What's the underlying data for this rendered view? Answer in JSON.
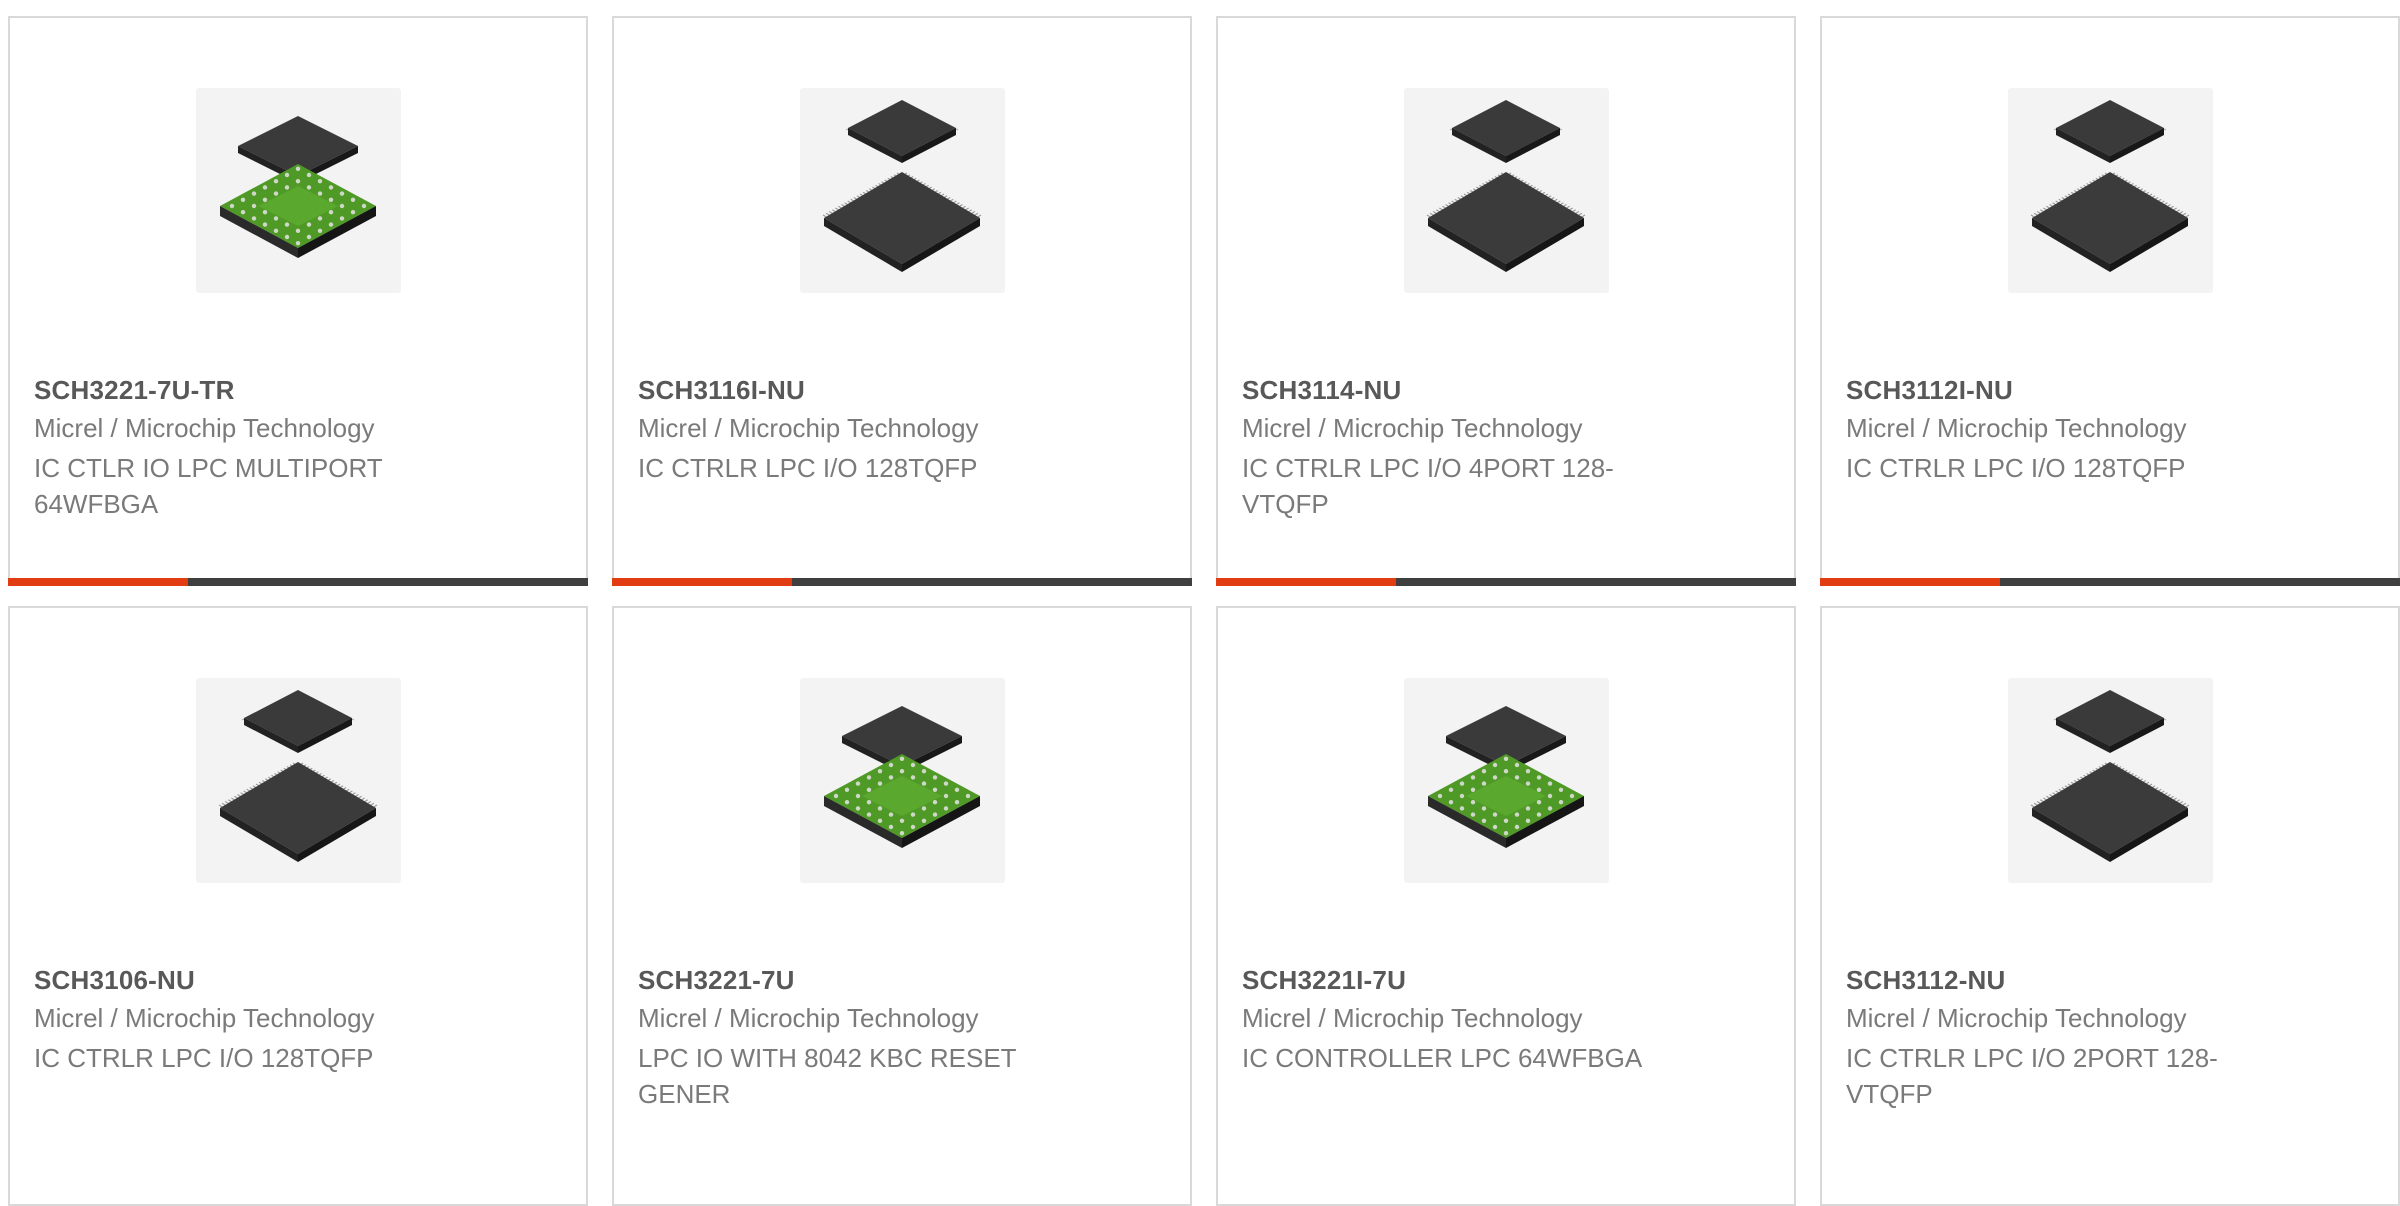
{
  "colors": {
    "accent": "#e23c12",
    "track": "#3f3f3f",
    "border": "#d9d9d9",
    "part_text": "#585858",
    "body_text": "#7a7a7a"
  },
  "products": [
    {
      "part": "SCH3221-7U-TR",
      "manufacturer": "Micrel / Microchip Technology",
      "description": "IC CTLR IO LPC MULTIPORT 64WFBGA",
      "image": "bga-chip-icon",
      "progress": 0.31
    },
    {
      "part": "SCH3116I-NU",
      "manufacturer": "Micrel / Microchip Technology",
      "description": "IC CTRLR LPC I/O 128TQFP",
      "image": "qfp-chip-icon",
      "progress": 0.31
    },
    {
      "part": "SCH3114-NU",
      "manufacturer": "Micrel / Microchip Technology",
      "description": "IC CTRLR LPC I/O 4PORT 128-VTQFP",
      "image": "qfp-chip-icon",
      "progress": 0.31
    },
    {
      "part": "SCH3112I-NU",
      "manufacturer": "Micrel / Microchip Technology",
      "description": "IC CTRLR LPC I/O 128TQFP",
      "image": "qfp-chip-icon",
      "progress": 0.31
    },
    {
      "part": "SCH3106-NU",
      "manufacturer": "Micrel / Microchip Technology",
      "description": "IC CTRLR LPC I/O 128TQFP",
      "image": "qfp-chip-icon",
      "progress": null
    },
    {
      "part": "SCH3221-7U",
      "manufacturer": "Micrel / Microchip Technology",
      "description": "LPC IO WITH 8042 KBC RESET GENER",
      "image": "bga-chip-icon",
      "progress": null
    },
    {
      "part": "SCH3221I-7U",
      "manufacturer": "Micrel / Microchip Technology",
      "description": "IC CONTROLLER LPC 64WFBGA",
      "image": "bga-chip-icon",
      "progress": null
    },
    {
      "part": "SCH3112-NU",
      "manufacturer": "Micrel / Microchip Technology",
      "description": "IC CTRLR LPC I/O 2PORT 128-VTQFP",
      "image": "qfp-chip-icon",
      "progress": null
    }
  ]
}
